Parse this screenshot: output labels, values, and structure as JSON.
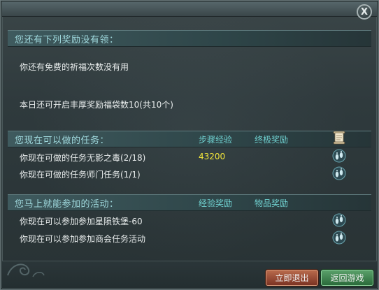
{
  "window": {
    "close_label": "X"
  },
  "section1": {
    "title": "您还有下列奖励没有领：",
    "items": [
      "你还有免费的祈福次数没有用",
      "本日还可开启丰厚奖励福袋数10(共10个)"
    ]
  },
  "section2": {
    "title": "您现在可以做的任务：",
    "col1": "步骤经验",
    "col2": "终极奖励",
    "rows": [
      {
        "label": "你现在可做的任务无影之毒(2/18)",
        "exp": "43200"
      },
      {
        "label": "你现在可做的任务师门任务(1/1)",
        "exp": ""
      }
    ]
  },
  "section3": {
    "title": "您马上就能参加的活动：",
    "col1": "经验奖励",
    "col2": "物品奖励",
    "rows": [
      {
        "label": "你现在可以参加参加星陨铁堡-60"
      },
      {
        "label": "你现在可以参加参加商会任务活动"
      }
    ]
  },
  "buttons": {
    "exit": "立即退出",
    "return": "返回游戏"
  },
  "icons": {
    "close": "close-icon",
    "scroll": "scroll-icon",
    "footprints": "footprints-icon"
  },
  "colors": {
    "header_text": "#9ed7db",
    "column_header": "#6fd0cf",
    "highlight_value": "#f3e63a",
    "body_text": "#e8ecec"
  }
}
